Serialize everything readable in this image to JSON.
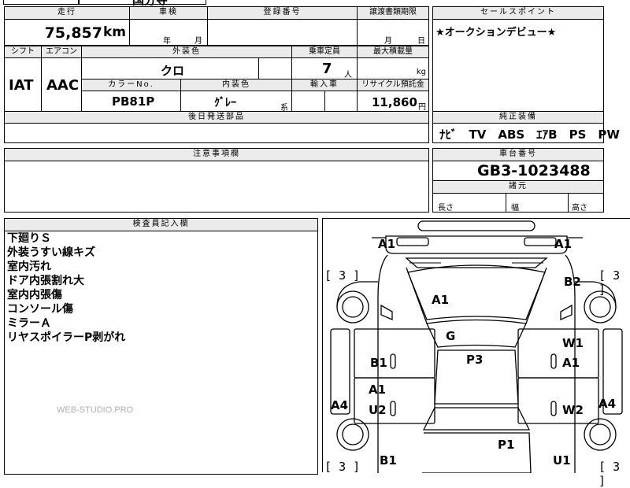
{
  "top_cut": {
    "text": "国分寺"
  },
  "mileage": {
    "header": "走行",
    "value": "75,857",
    "unit": "km"
  },
  "inspection": {
    "header": "車検",
    "year": "年",
    "month": "月"
  },
  "registration": {
    "header": "登録番号"
  },
  "transfer": {
    "header": "譲渡書類期限",
    "month": "月",
    "day": "日"
  },
  "sales_point": {
    "header": "セールスポイント",
    "text": "★オークションデビュー★"
  },
  "shift": {
    "header": "シフト",
    "value": "IAT"
  },
  "aircon": {
    "header": "エアコン",
    "value": "AAC"
  },
  "exterior": {
    "header": "外装色",
    "value": "クロ"
  },
  "capacity": {
    "header": "乗車定員",
    "value": "7",
    "unit": "人"
  },
  "max_load": {
    "header": "最大積載量",
    "unit": "kg"
  },
  "color_no": {
    "header": "カラーNo.",
    "value": "PB81P"
  },
  "interior": {
    "header": "内装色",
    "value": "ｸﾞﾚｰ",
    "suffix": "系"
  },
  "import": {
    "header": "輸入車"
  },
  "recycle": {
    "header": "リサイクル預託金",
    "value": "11,860",
    "unit": "円"
  },
  "later_parts": {
    "header": "後日発送部品"
  },
  "equipment": {
    "header": "純正装備",
    "value": "ﾅﾋﾞ　TV　ABS　ｴｱB　PS　PW"
  },
  "caution": {
    "header": "注意事項欄"
  },
  "chassis": {
    "header": "車台番号",
    "value": "GB3-1023488"
  },
  "dimensions": {
    "header": "諸元",
    "length": "長さ",
    "width": "幅",
    "height": "高さ"
  },
  "inspector": {
    "header": "検査員記入欄",
    "notes": [
      "下廻りＳ",
      "外装うすい線キズ",
      "室内汚れ",
      "ドア内張割れ大",
      "室内内張傷",
      "コンソール傷",
      "ミラーＡ",
      "リヤスポイラーP剥がれ"
    ],
    "watermark": "WEB-STUDIO.PRO"
  },
  "diagram": {
    "bracket_value": "3",
    "marks": {
      "a1_front_left": "A1",
      "a1_front_right": "A1",
      "b2_right": "B2",
      "a1_hood": "A1",
      "g_windshield": "G",
      "b1_left_front_door": "B1",
      "p3_roof": "P3",
      "w1_right_front_door": "W1",
      "a1_right_front_door": "A1",
      "a1_left_rear_door": "A1",
      "u2_left_rear_door": "U2",
      "a4_left": "A4",
      "a4_right": "A4",
      "w2_right_rear_door": "W2",
      "p1_rear": "P1",
      "b1_left_rear": "B1",
      "u1_right_rear": "U1"
    }
  }
}
